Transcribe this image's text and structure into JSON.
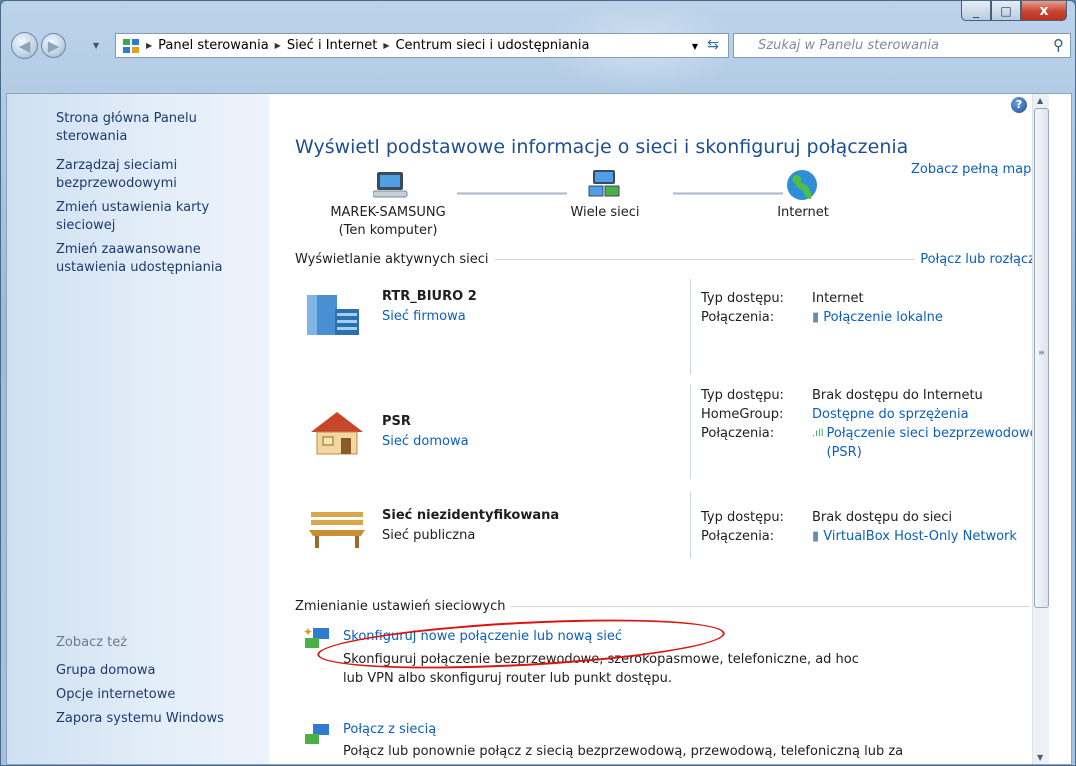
{
  "window": {
    "minimize": "_",
    "maximize": "□",
    "close": "x"
  },
  "nav": {
    "back_glyph": "◀",
    "forward_glyph": "▶",
    "breadcrumb": [
      "Panel sterowania",
      "Sieć i Internet",
      "Centrum sieci i udostępniania"
    ],
    "search_placeholder": "Szukaj w Panelu sterowania"
  },
  "sidebar": {
    "links": [
      "Strona główna Panelu sterowania",
      "Zarządzaj sieciami bezprzewodowymi",
      "Zmień ustawienia karty sieciowej",
      "Zmień zaawansowane ustawienia udostępniania"
    ],
    "see_also_label": "Zobacz też",
    "see_also": [
      "Grupa domowa",
      "Opcje internetowe",
      "Zapora systemu Windows"
    ]
  },
  "main": {
    "title": "Wyświetl podstawowe informacje o sieci i skonfiguruj połączenia",
    "full_map": "Zobacz pełną mapę",
    "map": {
      "computer": "MAREK-SAMSUNG",
      "computer_sub": "(Ten komputer)",
      "middle": "Wiele sieci",
      "internet": "Internet"
    },
    "active_header": "Wyświetlanie aktywnych sieci",
    "connect_link": "Połącz lub rozłącz",
    "networks": [
      {
        "name": "RTR_BIURO  2",
        "type": "Sieć firmowa",
        "type_is_link": true,
        "rows": [
          {
            "k": "Typ dostępu:",
            "v": "Internet"
          },
          {
            "k": "Połączenia:",
            "v": "Połączenie lokalne",
            "link": true
          }
        ]
      },
      {
        "name": "PSR",
        "type": "Sieć domowa",
        "type_is_link": true,
        "rows": [
          {
            "k": "Typ dostępu:",
            "v": "Brak dostępu do Internetu"
          },
          {
            "k": "HomeGroup:",
            "v": "Dostępne do sprzężenia",
            "link": true
          },
          {
            "k": "Połączenia:",
            "v": "Połączenie sieci bezprzewodowej (PSR)",
            "link": true
          }
        ]
      },
      {
        "name": "Sieć niezidentyfikowana",
        "type": "Sieć publiczna",
        "type_is_link": false,
        "rows": [
          {
            "k": "Typ dostępu:",
            "v": "Brak dostępu do sieci"
          },
          {
            "k": "Połączenia:",
            "v": "VirtualBox Host-Only Network",
            "link": true
          }
        ]
      }
    ],
    "change_header": "Zmienianie ustawień sieciowych",
    "tasks": [
      {
        "title": "Skonfiguruj nowe połączenie lub nową sieć",
        "desc": "Skonfiguruj połączenie bezprzewodowe, szerokopasmowe, telefoniczne, ad hoc lub VPN albo skonfiguruj router lub punkt dostępu."
      },
      {
        "title": "Połącz z siecią",
        "desc": "Połącz lub ponownie połącz z siecią bezprzewodową, przewodową, telefoniczną lub za"
      }
    ],
    "help_glyph": "?"
  },
  "colors": {
    "link": "#0b5ebf",
    "title": "#1e4f94",
    "highlight_oval": "#d8150e"
  }
}
